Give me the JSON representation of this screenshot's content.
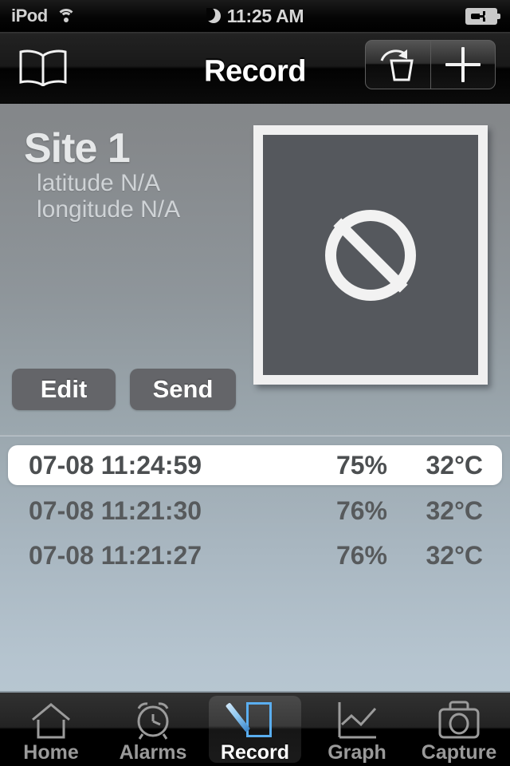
{
  "status_bar": {
    "carrier": "iPod",
    "wifi_icon": "wifi-icon",
    "dnd_icon": "moon-icon",
    "time": "11:25 AM",
    "battery_icon": "battery-charging-icon"
  },
  "nav_bar": {
    "title": "Record",
    "back_icon": "book-icon",
    "delete_icon": "undo-trash-icon",
    "add_icon": "plus-icon"
  },
  "site": {
    "name": "Site 1",
    "latitude": "latitude N/A",
    "longitude": "longitude N/A",
    "photo_placeholder_icon": "no-entry-icon"
  },
  "actions": {
    "edit_label": "Edit",
    "send_label": "Send"
  },
  "records": [
    {
      "timestamp": "07-08 11:24:59",
      "humidity": "75%",
      "temperature": "32°C",
      "selected": true
    },
    {
      "timestamp": "07-08 11:21:30",
      "humidity": "76%",
      "temperature": "32°C",
      "selected": false
    },
    {
      "timestamp": "07-08 11:21:27",
      "humidity": "76%",
      "temperature": "32°C",
      "selected": false
    }
  ],
  "tab_bar": {
    "active": "Record",
    "items": [
      {
        "label": "Home",
        "icon": "home-icon"
      },
      {
        "label": "Alarms",
        "icon": "alarm-clock-icon"
      },
      {
        "label": "Record",
        "icon": "pen-note-icon"
      },
      {
        "label": "Graph",
        "icon": "line-chart-icon"
      },
      {
        "label": "Capture",
        "icon": "camera-icon"
      }
    ]
  },
  "colors": {
    "accent_blue": "#5aaef0",
    "photo_fill": "#55585d",
    "button_gray": "#646569",
    "list_text": "#575a5c",
    "background_top": "#7f8285",
    "background_bottom": "#bbcad4"
  }
}
